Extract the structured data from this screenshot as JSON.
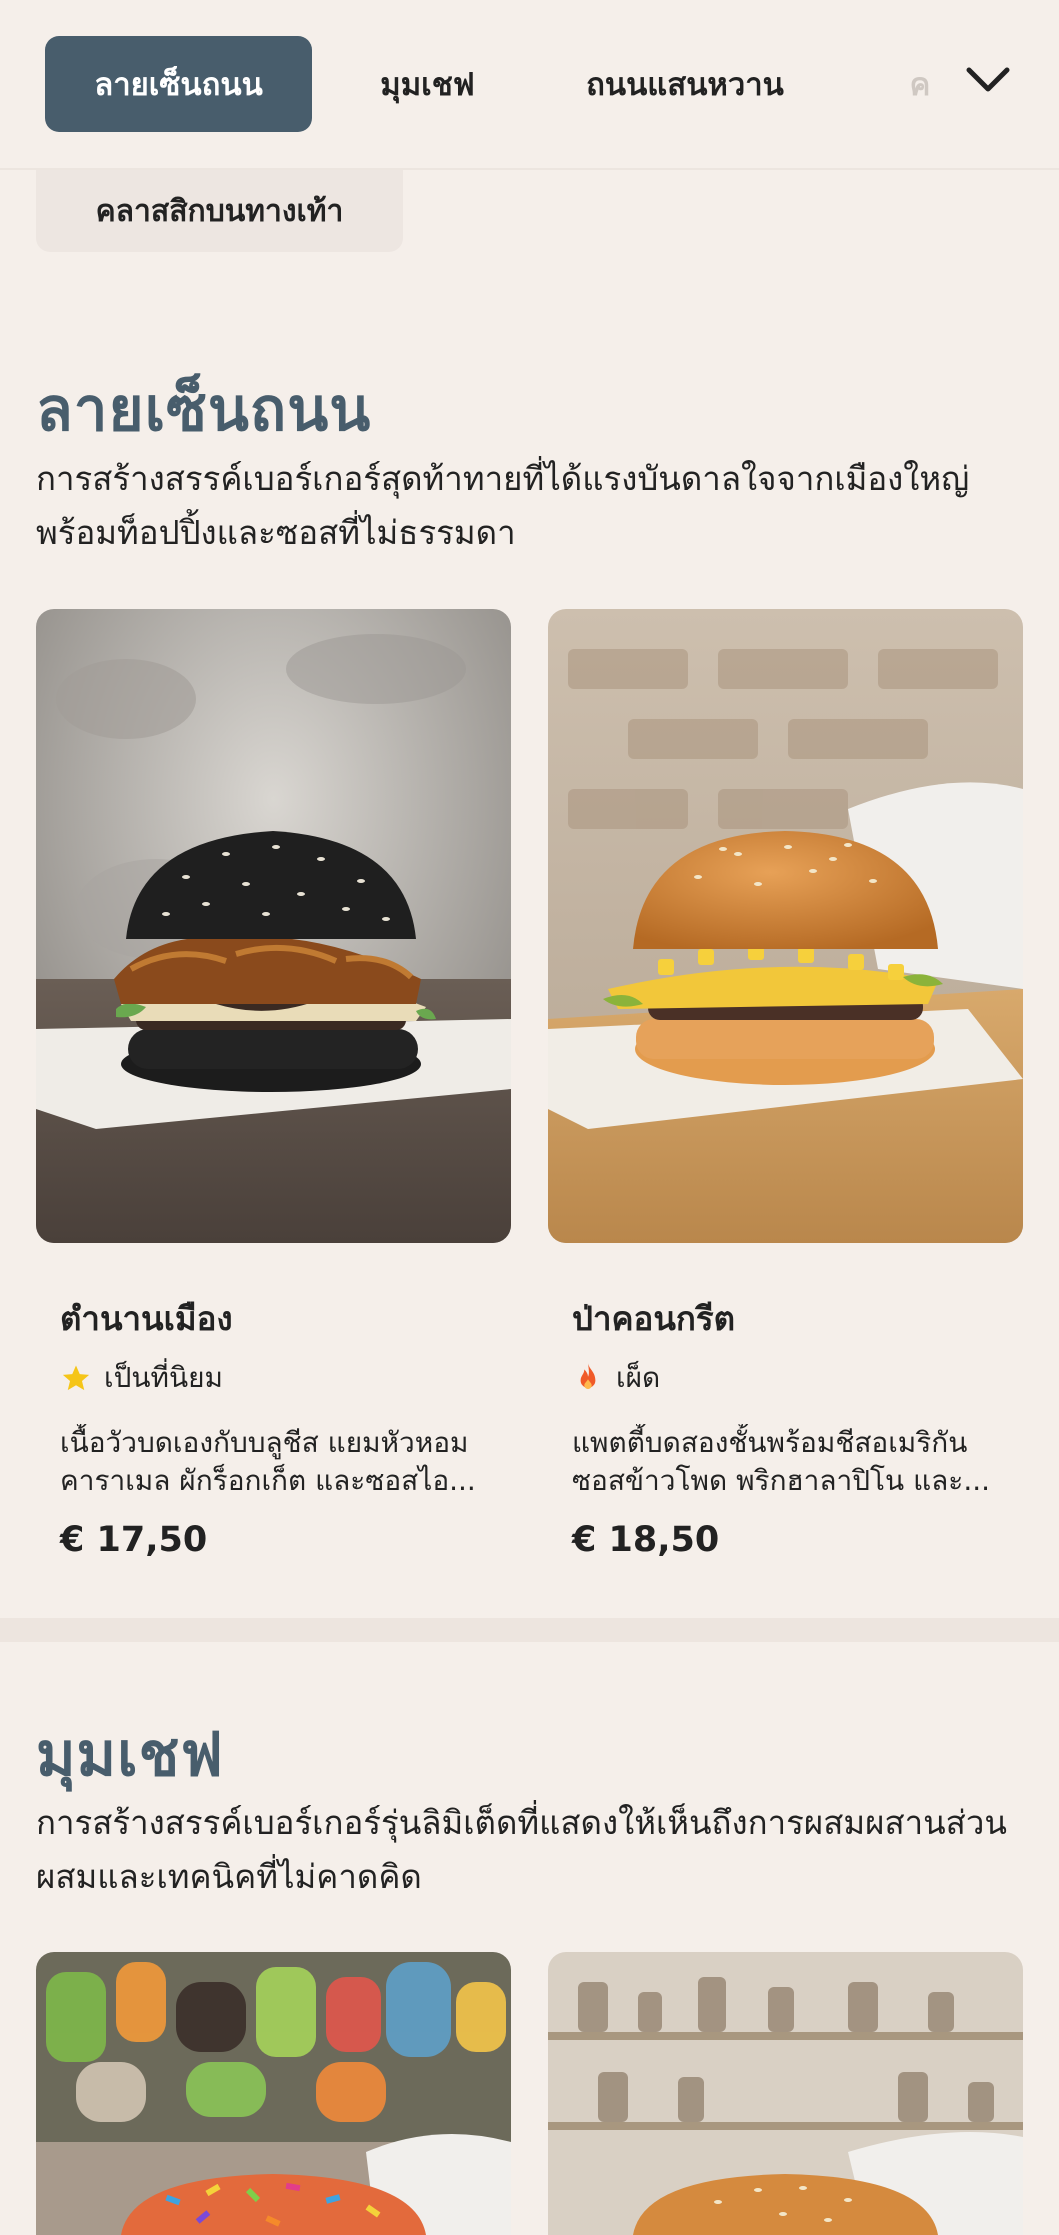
{
  "nav": {
    "tabs": [
      {
        "label": "ลายเซ็นถนน",
        "active": true
      },
      {
        "label": "มุมเชฟ",
        "active": false
      },
      {
        "label": "ถนนแสนหวาน",
        "active": false
      },
      {
        "label": "ค",
        "active": false
      }
    ],
    "expand_icon": "chevron-down-icon",
    "sub_tab": "คลาสสิกบนทางเท้า"
  },
  "sections": [
    {
      "title": "ลายเซ็นถนน",
      "description": "การสร้างสรรค์เบอร์เกอร์สุดท้าทายที่ได้แรงบันดาลใจจากเมืองใหญ่ พร้อมท็อปปิ้งและซอสที่ไม่ธรรมดา",
      "items": [
        {
          "name": "ตำนานเมือง",
          "badge_icon": "star-icon",
          "badge": "เป็นที่นิยม",
          "description": "เนื้อวัวบดเองกับบลูชีส แยมหัวหอมคาราเมล ผักร็อกเก็ต และซอสไอ...",
          "price": "€ 17,50"
        },
        {
          "name": "ป่าคอนกรีต",
          "badge_icon": "flame-icon",
          "badge": "เผ็ด",
          "description": "แพตตี้บดสองชั้นพร้อมชีสอเมริกัน ซอสข้าวโพด พริกฮาลาปิโน และ...",
          "price": "€ 18,50"
        }
      ]
    },
    {
      "title": "มุมเชฟ",
      "description": "การสร้างสรรค์เบอร์เกอร์รุ่นลิมิเต็ดที่แสดงให้เห็นถึงการผสมผสานส่วนผสมและเทคนิคที่ไม่คาดคิด"
    }
  ],
  "colors": {
    "background": "#f5efea",
    "accent": "#485d6c",
    "star": "#f5c518",
    "flame": "#f05a28"
  }
}
